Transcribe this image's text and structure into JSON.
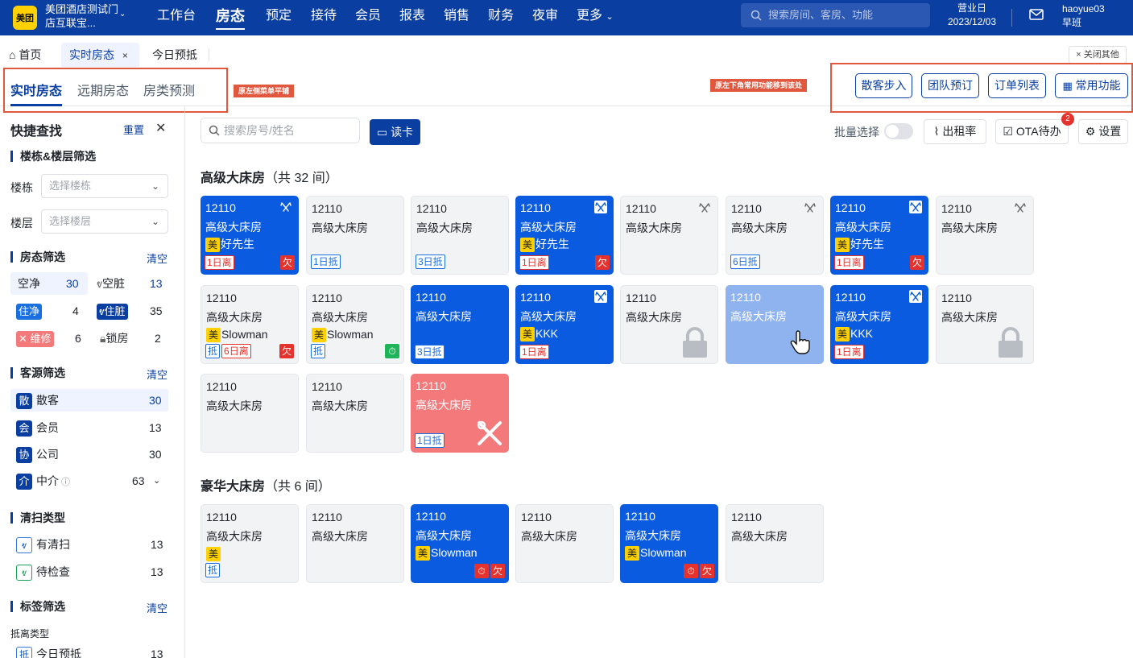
{
  "header": {
    "logo": "美团",
    "store_name": "美团酒店测试门店互联宝...",
    "nav": [
      "工作台",
      "房态",
      "预定",
      "接待",
      "会员",
      "报表",
      "销售",
      "财务",
      "夜审",
      "更多"
    ],
    "active_nav": "房态",
    "search_placeholder": "搜索房间、客房、功能",
    "biz_day_label": "营业日",
    "biz_day_date": "2023/12/03",
    "username": "haoyue03",
    "shift": "早班"
  },
  "tabs": {
    "home": "首页",
    "realtime": "实时房态",
    "today": "今日预抵",
    "close_others": "关闭其他"
  },
  "subtabs": [
    "实时房态",
    "远期房态",
    "房类预测"
  ],
  "annotations": {
    "left": "原左侧菜单平铺",
    "right": "原左下角常用功能移到该处"
  },
  "quick_actions": [
    "散客步入",
    "团队预订",
    "订单列表",
    "常用功能"
  ],
  "sidebar": {
    "title": "快捷查找",
    "reset": "重置",
    "building_section": "楼栋&楼层筛选",
    "building_label": "楼栋",
    "building_placeholder": "选择楼栋",
    "floor_label": "楼层",
    "floor_placeholder": "选择楼层",
    "status_section": "房态筛选",
    "clear": "清空",
    "status": [
      {
        "label": "空净",
        "count": "30"
      },
      {
        "label": "空脏",
        "count": "13"
      },
      {
        "label": "住净",
        "count": "4"
      },
      {
        "label": "住脏",
        "count": "35"
      },
      {
        "label": "维修",
        "count": "6"
      },
      {
        "label": "锁房",
        "count": "2"
      }
    ],
    "source_section": "客源筛选",
    "sources": [
      {
        "icon": "散",
        "label": "散客",
        "count": "30"
      },
      {
        "icon": "会",
        "label": "会员",
        "count": "13"
      },
      {
        "icon": "协",
        "label": "公司",
        "count": "30"
      },
      {
        "icon": "介",
        "label": "中介",
        "count": "63"
      }
    ],
    "clean_section": "清扫类型",
    "clean": [
      {
        "label": "有清扫",
        "count": "13"
      },
      {
        "label": "待检查",
        "count": "13"
      }
    ],
    "tag_section": "标签筛选",
    "arrival_type": "抵离类型",
    "arrival": [
      {
        "icon": "抵",
        "label": "今日预抵",
        "count": "13"
      }
    ]
  },
  "toolbar": {
    "search_placeholder": "搜索房号/姓名",
    "read_card": "读卡",
    "batch": "批量选择",
    "occupancy": "出租率",
    "ota": "OTA待办",
    "ota_badge": "2",
    "settings": "设置"
  },
  "groups": [
    {
      "name": "高级大床房",
      "count": "（共 32 间）"
    },
    {
      "name": "豪华大床房",
      "count": "（共 6 间）"
    }
  ],
  "rooms": [
    {
      "num": "12110",
      "type": "高级大床房",
      "guest": "好先生",
      "mei": "美",
      "bl": [
        "1日离"
      ],
      "qian": "欠"
    },
    {
      "num": "12110",
      "type": "高级大床房",
      "bl": [
        "1日抵"
      ]
    },
    {
      "num": "12110",
      "type": "高级大床房",
      "bl": [
        "3日抵"
      ]
    },
    {
      "num": "12110",
      "type": "高级大床房",
      "guest": "好先生",
      "mei": "美",
      "bl": [
        "1日离"
      ],
      "qian": "欠"
    },
    {
      "num": "12110",
      "type": "高级大床房"
    },
    {
      "num": "12110",
      "type": "高级大床房",
      "bl": [
        "6日抵"
      ]
    },
    {
      "num": "12110",
      "type": "高级大床房",
      "guest": "好先生",
      "mei": "美",
      "bl": [
        "1日离"
      ],
      "qian": "欠"
    },
    {
      "num": "12110",
      "type": "高级大床房"
    },
    {
      "num": "12110",
      "type": "高级大床房",
      "guest": "Slowman",
      "mei": "美",
      "bl": [
        "抵",
        "6日离"
      ],
      "qian": "欠"
    },
    {
      "num": "12110",
      "type": "高级大床房",
      "guest": "Slowman",
      "mei": "美",
      "bl": [
        "抵"
      ]
    },
    {
      "num": "12110",
      "type": "高级大床房",
      "bl": [
        "3日抵"
      ]
    },
    {
      "num": "12110",
      "type": "高级大床房",
      "guest": "KKK",
      "mei": "美",
      "bl": [
        "1日离"
      ]
    },
    {
      "num": "12110",
      "type": "高级大床房"
    },
    {
      "num": "12110",
      "type": "高级大床房"
    },
    {
      "num": "12110",
      "type": "高级大床房",
      "guest": "KKK",
      "mei": "美",
      "bl": [
        "1日离"
      ]
    },
    {
      "num": "12110",
      "type": "高级大床房"
    },
    {
      "num": "12110",
      "type": "高级大床房"
    },
    {
      "num": "12110",
      "type": "高级大床房"
    },
    {
      "num": "12110",
      "type": "高级大床房",
      "bl": [
        "1日抵"
      ]
    },
    {
      "num": "12110",
      "type": "高级大床房",
      "mei": "美",
      "bl": [
        "抵"
      ]
    },
    {
      "num": "12110",
      "type": "高级大床房"
    },
    {
      "num": "12110",
      "type": "高级大床房",
      "guest": "Slowman",
      "mei": "美",
      "qian": "欠"
    },
    {
      "num": "12110",
      "type": "高级大床房"
    },
    {
      "num": "12110",
      "type": "高级大床房",
      "guest": "Slowman",
      "mei": "美",
      "qian": "欠"
    },
    {
      "num": "12110",
      "type": "高级大床房"
    }
  ]
}
